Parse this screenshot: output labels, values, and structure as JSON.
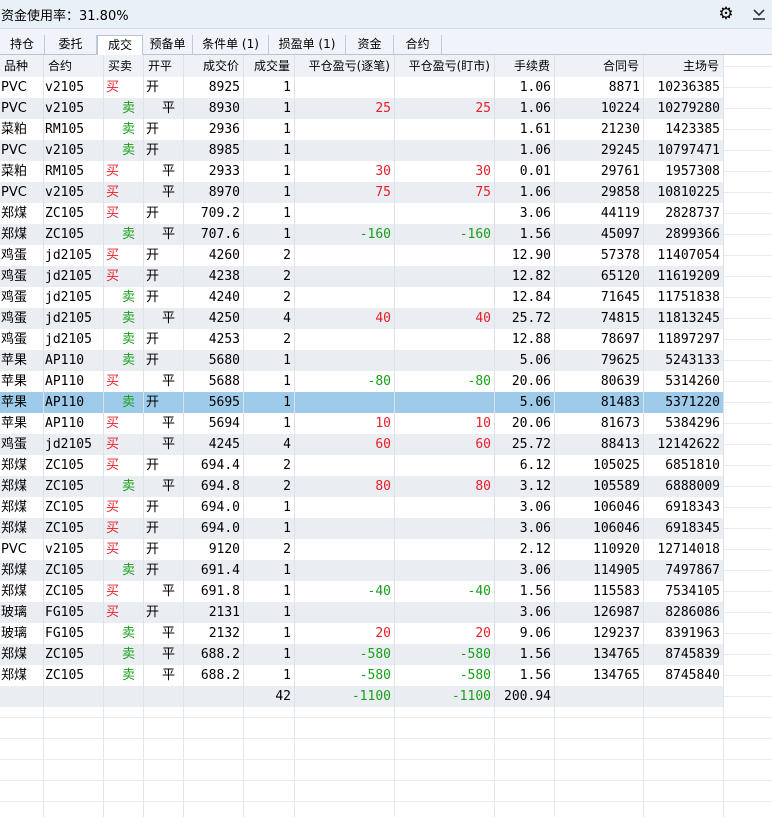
{
  "header": {
    "utilization_label": "资金使用率：31.80%",
    "settings_icon": "gear-icon",
    "collapse_icon": "chevron-down-icon"
  },
  "tabs": [
    {
      "label": "持仓"
    },
    {
      "label": "委托"
    },
    {
      "label": "成交",
      "active": true
    },
    {
      "label": "预备单"
    },
    {
      "label": "条件单 (1)"
    },
    {
      "label": "损盈单 (1)"
    },
    {
      "label": "资金"
    },
    {
      "label": "合约"
    }
  ],
  "table": {
    "columns": [
      "品种",
      "合约",
      "买卖",
      "开平",
      "成交价",
      "成交量",
      "平仓盈亏(逐笔)",
      "平仓盈亏(盯市)",
      "手续费",
      "合同号",
      "主场号"
    ],
    "rows": [
      [
        "PVC",
        "v2105",
        "买",
        "开",
        "8925",
        "1",
        "",
        "",
        "1.06",
        "8871",
        "10236385"
      ],
      [
        "PVC",
        "v2105",
        "卖",
        "平",
        "8930",
        "1",
        "25",
        "25",
        "1.06",
        "10224",
        "10279280"
      ],
      [
        "菜粕",
        "RM105",
        "卖",
        "开",
        "2936",
        "1",
        "",
        "",
        "1.61",
        "21230",
        "1423385"
      ],
      [
        "PVC",
        "v2105",
        "卖",
        "开",
        "8985",
        "1",
        "",
        "",
        "1.06",
        "29245",
        "10797471"
      ],
      [
        "菜粕",
        "RM105",
        "买",
        "平",
        "2933",
        "1",
        "30",
        "30",
        "0.01",
        "29761",
        "1957308"
      ],
      [
        "PVC",
        "v2105",
        "买",
        "平",
        "8970",
        "1",
        "75",
        "75",
        "1.06",
        "29858",
        "10810225"
      ],
      [
        "郑煤",
        "ZC105",
        "买",
        "开",
        "709.2",
        "1",
        "",
        "",
        "3.06",
        "44119",
        "2828737"
      ],
      [
        "郑煤",
        "ZC105",
        "卖",
        "平",
        "707.6",
        "1",
        "-160",
        "-160",
        "1.56",
        "45097",
        "2899366"
      ],
      [
        "鸡蛋",
        "jd2105",
        "买",
        "开",
        "4260",
        "2",
        "",
        "",
        "12.90",
        "57378",
        "11407054"
      ],
      [
        "鸡蛋",
        "jd2105",
        "买",
        "开",
        "4238",
        "2",
        "",
        "",
        "12.82",
        "65120",
        "11619209"
      ],
      [
        "鸡蛋",
        "jd2105",
        "卖",
        "开",
        "4240",
        "2",
        "",
        "",
        "12.84",
        "71645",
        "11751838"
      ],
      [
        "鸡蛋",
        "jd2105",
        "卖",
        "平",
        "4250",
        "4",
        "40",
        "40",
        "25.72",
        "74815",
        "11813245"
      ],
      [
        "鸡蛋",
        "jd2105",
        "卖",
        "开",
        "4253",
        "2",
        "",
        "",
        "12.88",
        "78697",
        "11897297"
      ],
      [
        "苹果",
        "AP110",
        "卖",
        "开",
        "5680",
        "1",
        "",
        "",
        "5.06",
        "79625",
        "5243133"
      ],
      [
        "苹果",
        "AP110",
        "买",
        "平",
        "5688",
        "1",
        "-80",
        "-80",
        "20.06",
        "80639",
        "5314260"
      ],
      [
        "苹果",
        "AP110",
        "卖",
        "开",
        "5695",
        "1",
        "",
        "",
        "5.06",
        "81483",
        "5371220"
      ],
      [
        "苹果",
        "AP110",
        "买",
        "平",
        "5694",
        "1",
        "10",
        "10",
        "20.06",
        "81673",
        "5384296"
      ],
      [
        "鸡蛋",
        "jd2105",
        "买",
        "平",
        "4245",
        "4",
        "60",
        "60",
        "25.72",
        "88413",
        "12142622"
      ],
      [
        "郑煤",
        "ZC105",
        "买",
        "开",
        "694.4",
        "2",
        "",
        "",
        "6.12",
        "105025",
        "6851810"
      ],
      [
        "郑煤",
        "ZC105",
        "卖",
        "平",
        "694.8",
        "2",
        "80",
        "80",
        "3.12",
        "105589",
        "6888009"
      ],
      [
        "郑煤",
        "ZC105",
        "买",
        "开",
        "694.0",
        "1",
        "",
        "",
        "3.06",
        "106046",
        "6918343"
      ],
      [
        "郑煤",
        "ZC105",
        "买",
        "开",
        "694.0",
        "1",
        "",
        "",
        "3.06",
        "106046",
        "6918345"
      ],
      [
        "PVC",
        "v2105",
        "买",
        "开",
        "9120",
        "2",
        "",
        "",
        "2.12",
        "110920",
        "12714018"
      ],
      [
        "郑煤",
        "ZC105",
        "卖",
        "开",
        "691.4",
        "1",
        "",
        "",
        "3.06",
        "114905",
        "7497867"
      ],
      [
        "郑煤",
        "ZC105",
        "买",
        "平",
        "691.8",
        "1",
        "-40",
        "-40",
        "1.56",
        "115583",
        "7534105"
      ],
      [
        "玻璃",
        "FG105",
        "买",
        "开",
        "2131",
        "1",
        "",
        "",
        "3.06",
        "126987",
        "8286086"
      ],
      [
        "玻璃",
        "FG105",
        "卖",
        "平",
        "2132",
        "1",
        "20",
        "20",
        "9.06",
        "129237",
        "8391963"
      ],
      [
        "郑煤",
        "ZC105",
        "卖",
        "平",
        "688.2",
        "1",
        "-580",
        "-580",
        "1.56",
        "134765",
        "8745839"
      ],
      [
        "郑煤",
        "ZC105",
        "卖",
        "平",
        "688.2",
        "1",
        "-580",
        "-580",
        "1.56",
        "134765",
        "8745840"
      ]
    ],
    "selected_row": 15,
    "totals": {
      "volume": "42",
      "pnl_trade": "-1100",
      "pnl_mark": "-1100",
      "fee": "200.94"
    }
  },
  "colors": {
    "buy": "#e8202a",
    "sell": "#18a018",
    "profit": "#e8202a",
    "loss": "#18a018",
    "selected": "#9fcbea"
  }
}
